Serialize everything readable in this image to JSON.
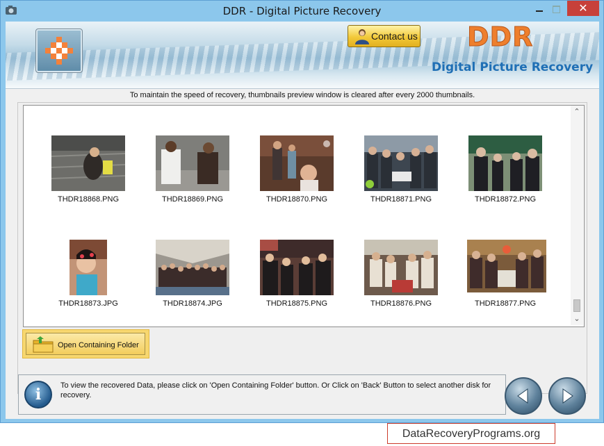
{
  "window": {
    "title": "DDR - Digital Picture Recovery",
    "close_glyph": "✕"
  },
  "banner": {
    "contact_label": "Contact us",
    "brand": "DDR",
    "subtitle": "Digital Picture Recovery"
  },
  "notice": "To maintain the speed of recovery, thumbnails preview window is cleared after every 2000 thumbnails.",
  "thumbnails": [
    {
      "name": "THDR18868.PNG"
    },
    {
      "name": "THDR18869.PNG"
    },
    {
      "name": "THDR18870.PNG"
    },
    {
      "name": "THDR18871.PNG"
    },
    {
      "name": "THDR18872.PNG"
    },
    {
      "name": "THDR18873.JPG"
    },
    {
      "name": "THDR18874.JPG"
    },
    {
      "name": "THDR18875.PNG"
    },
    {
      "name": "THDR18876.PNG"
    },
    {
      "name": "THDR18877.PNG"
    }
  ],
  "actions": {
    "open_folder_label": "Open Containing Folder"
  },
  "status": {
    "info_glyph": "i",
    "message": "To view the recovered Data, please click on 'Open Containing Folder' button. Or Click on 'Back' Button to select another disk for recovery."
  },
  "watermark": "DataRecoveryPrograms.org",
  "colors": {
    "titlebar": "#8cc7ec",
    "close_button": "#c7403a",
    "brand_orange": "#ee7f2d",
    "brand_blue": "#1f6fb5",
    "highlight_button": "#f7d76f"
  }
}
